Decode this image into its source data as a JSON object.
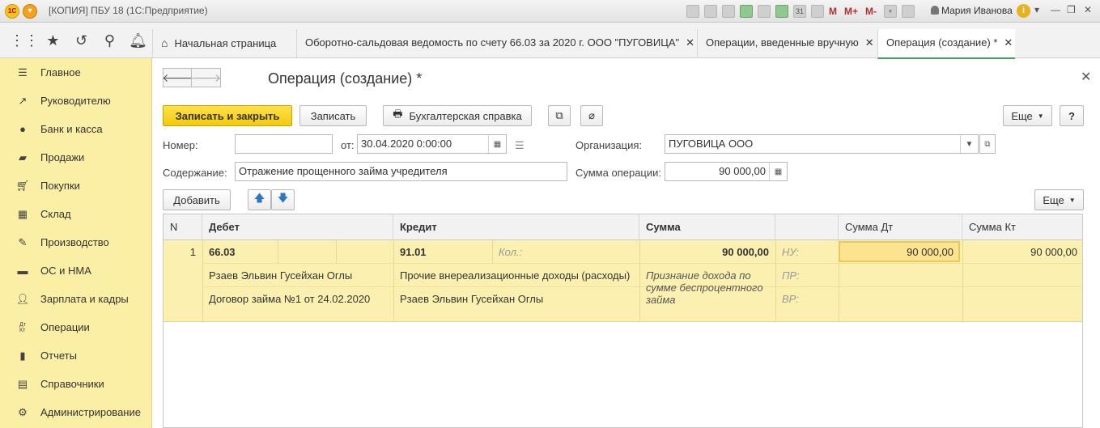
{
  "app": {
    "logo_text": "1С",
    "window_title": "[КОПИЯ] ПБУ 18  (1С:Предприятие)",
    "user": "Мария Иванова",
    "memory_buttons": [
      "M",
      "M+",
      "M-"
    ]
  },
  "tabs": [
    {
      "label": "Начальная страница"
    },
    {
      "label": "Оборотно-сальдовая ведомость по счету 66.03 за 2020 г. ООО \"ПУГОВИЦА\""
    },
    {
      "label": "Операции, введенные вручную"
    },
    {
      "label": "Операция (создание) *"
    }
  ],
  "sidebar": {
    "items": [
      {
        "label": "Главное",
        "icon": "menu-icon"
      },
      {
        "label": "Руководителю",
        "icon": "chart-line-icon"
      },
      {
        "label": "Банк и касса",
        "icon": "coin-icon"
      },
      {
        "label": "Продажи",
        "icon": "bag-icon"
      },
      {
        "label": "Покупки",
        "icon": "cart-icon"
      },
      {
        "label": "Склад",
        "icon": "warehouse-icon"
      },
      {
        "label": "Производство",
        "icon": "wrench-icon"
      },
      {
        "label": "ОС и НМА",
        "icon": "truck-icon"
      },
      {
        "label": "Зарплата и кадры",
        "icon": "person-icon"
      },
      {
        "label": "Операции",
        "icon": "dt-kt-icon"
      },
      {
        "label": "Отчеты",
        "icon": "bar-chart-icon"
      },
      {
        "label": "Справочники",
        "icon": "book-icon"
      },
      {
        "label": "Администрирование",
        "icon": "gear-icon"
      }
    ]
  },
  "form": {
    "title": "Операция (создание) *",
    "buttons": {
      "save_close": "Записать и закрыть",
      "save": "Записать",
      "accounting_note": "Бухгалтерская справка",
      "more": "Еще",
      "help": "?",
      "add": "Добавить",
      "more2": "Еще"
    },
    "fields": {
      "number_label": "Номер:",
      "number_value": "",
      "date_label": "от:",
      "date_value": "30.04.2020  0:00:00",
      "org_label": "Организация:",
      "org_value": "ПУГОВИЦА ООО",
      "content_label": "Содержание:",
      "content_value": "Отражение прощенного займа учредителя",
      "sum_label": "Сумма операции:",
      "sum_value": "90 000,00"
    }
  },
  "table": {
    "headers": {
      "n": "N",
      "debit": "Дебет",
      "credit": "Кредит",
      "sum": "Сумма",
      "sum_dt": "Сумма Дт",
      "sum_kt": "Сумма Кт"
    },
    "rows": [
      {
        "n": "1",
        "debit_account": "66.03",
        "debit_sub1": "Рзаев Эльвин Гусейхан Оглы",
        "debit_sub2": "Договор займа №1 от 24.02.2020",
        "credit_account": "91.01",
        "credit_qty_label": "Кол.:",
        "credit_sub1": "Прочие внереализационные доходы (расходы)",
        "credit_sub2": "Рзаев Эльвин Гусейхан Оглы",
        "sum": "90 000,00",
        "description": "Признание дохода по сумме беспроцентного займа",
        "nu_label": "НУ:",
        "pr_label": "ПР:",
        "vr_label": "ВР:",
        "sum_dt": "90 000,00",
        "sum_kt": "90 000,00"
      }
    ]
  }
}
